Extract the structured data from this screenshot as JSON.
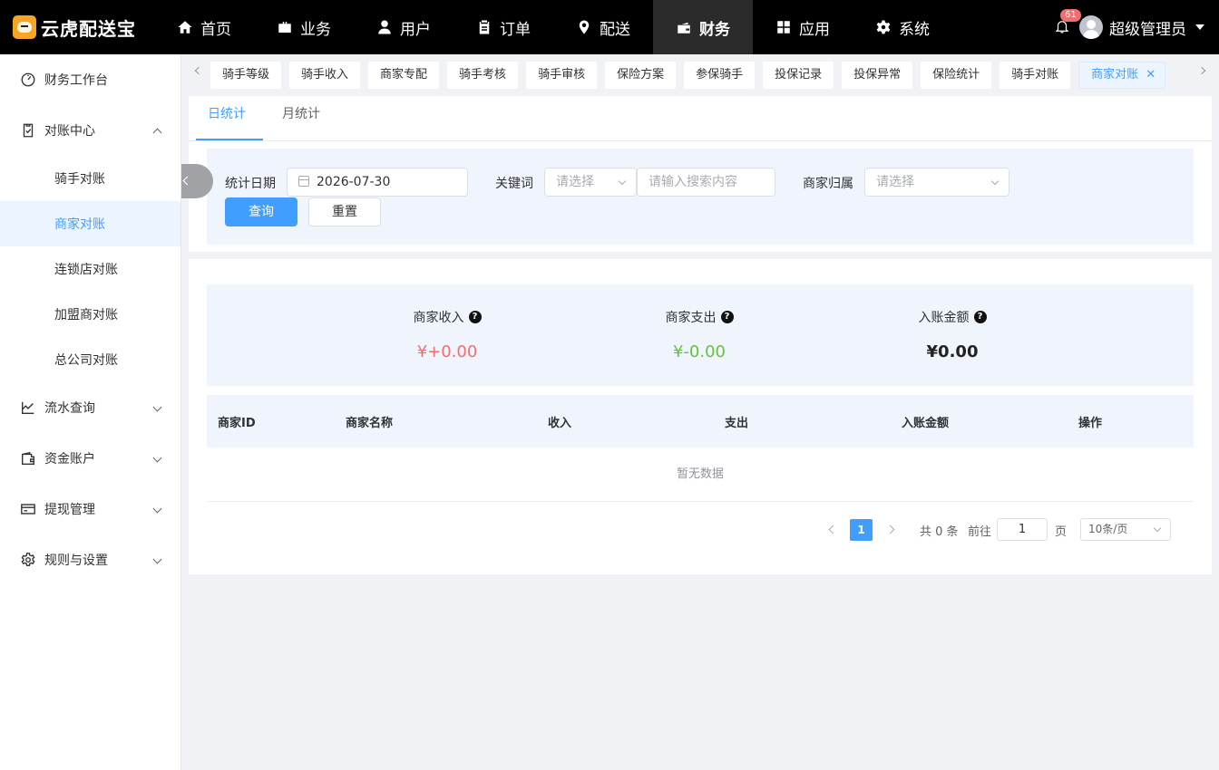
{
  "app": {
    "logo_text": "云虎配送宝"
  },
  "topnav": [
    {
      "label": "首页",
      "icon": "home-icon"
    },
    {
      "label": "业务",
      "icon": "briefcase-icon"
    },
    {
      "label": "用户",
      "icon": "user-icon"
    },
    {
      "label": "订单",
      "icon": "clipboard-icon"
    },
    {
      "label": "配送",
      "icon": "location-icon"
    },
    {
      "label": "财务",
      "icon": "wallet-icon",
      "active": true
    },
    {
      "label": "应用",
      "icon": "grid-icon"
    },
    {
      "label": "系统",
      "icon": "gear-icon"
    }
  ],
  "user": {
    "notifications": "61",
    "name": "超级管理员"
  },
  "sidebar": {
    "items": [
      {
        "label": "财务工作台",
        "icon": "dashboard-icon"
      },
      {
        "label": "对账中心",
        "icon": "reconcile-icon",
        "expanded": true,
        "children": [
          {
            "label": "骑手对账"
          },
          {
            "label": "商家对账",
            "active": true
          },
          {
            "label": "连锁店对账"
          },
          {
            "label": "加盟商对账"
          },
          {
            "label": "总公司对账"
          }
        ]
      },
      {
        "label": "流水查询",
        "icon": "chart-icon"
      },
      {
        "label": "资金账户",
        "icon": "account-icon"
      },
      {
        "label": "提现管理",
        "icon": "card-icon"
      },
      {
        "label": "规则与设置",
        "icon": "settings-icon"
      }
    ]
  },
  "tags": [
    "骑手等级",
    "骑手收入",
    "商家专配",
    "骑手考核",
    "骑手审核",
    "保险方案",
    "参保骑手",
    "投保记录",
    "投保异常",
    "保险统计",
    "骑手对账",
    "商家对账"
  ],
  "tabs": [
    "日统计",
    "月统计"
  ],
  "filters": {
    "date_label": "统计日期",
    "date_value": "2026-07-30",
    "keyword_label": "关键词",
    "keyword_select_placeholder": "请选择",
    "keyword_input_placeholder": "请输入搜索内容",
    "merchant_owner_label": "商家归属",
    "merchant_owner_placeholder": "请选择",
    "query_button": "查询",
    "reset_button": "重置"
  },
  "summary": {
    "income_label": "商家收入",
    "income_value": "¥+0.00",
    "expense_label": "商家支出",
    "expense_value": "¥-0.00",
    "credited_label": "入账金额",
    "credited_value": "¥0.00"
  },
  "table": {
    "columns": [
      "商家ID",
      "商家名称",
      "收入",
      "支出",
      "入账金额",
      "操作"
    ],
    "empty_text": "暂无数据"
  },
  "pagination": {
    "current_page": "1",
    "total_text": "共 0 条",
    "goto_label": "前往",
    "goto_value": "1",
    "page_suffix": "页",
    "page_size": "10条/页"
  }
}
